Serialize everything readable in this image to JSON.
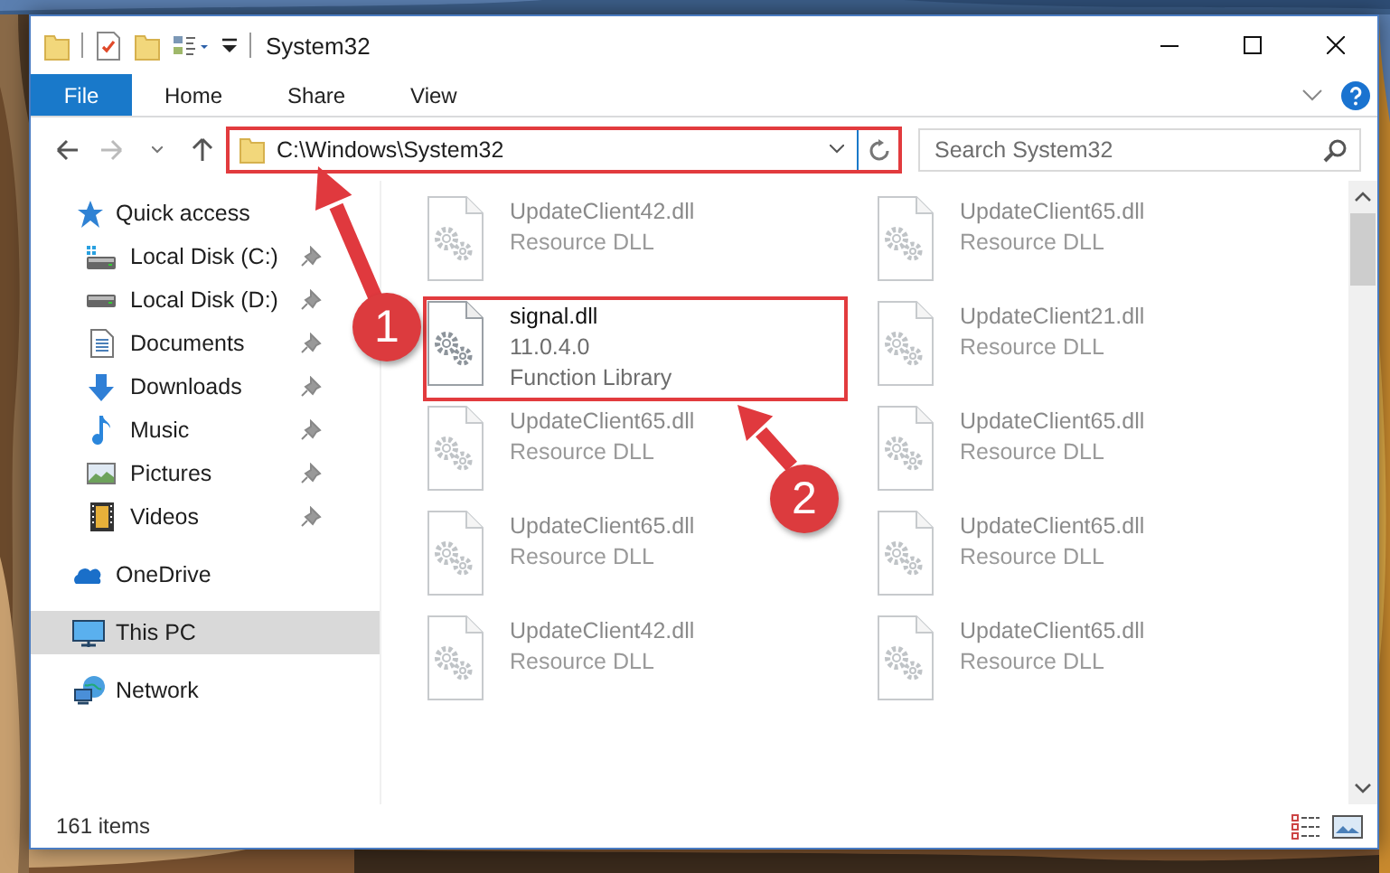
{
  "window": {
    "title": "System32"
  },
  "ribbon": {
    "tabs": [
      {
        "label": "File",
        "kind": "file"
      },
      {
        "label": "Home",
        "kind": "tab"
      },
      {
        "label": "Share",
        "kind": "tab"
      },
      {
        "label": "View",
        "kind": "tab"
      }
    ]
  },
  "address_bar": {
    "path": "C:\\Windows\\System32",
    "highlighted": true
  },
  "search": {
    "placeholder": "Search System32"
  },
  "navigation": [
    {
      "label": "Quick access",
      "selected": false,
      "children": [
        {
          "label": "Local Disk (C:)",
          "pinned": true,
          "selected": false
        },
        {
          "label": "Local Disk (D:)",
          "pinned": true,
          "selected": false
        },
        {
          "label": "Documents",
          "pinned": true,
          "selected": false
        },
        {
          "label": "Downloads",
          "pinned": true,
          "selected": false
        },
        {
          "label": "Music",
          "pinned": true,
          "selected": false
        },
        {
          "label": "Pictures",
          "pinned": true,
          "selected": false
        },
        {
          "label": "Videos",
          "pinned": true,
          "selected": false
        }
      ]
    },
    {
      "label": "OneDrive",
      "selected": false
    },
    {
      "label": "This PC",
      "selected": true
    },
    {
      "label": "Network",
      "selected": false
    }
  ],
  "files": [
    {
      "name": "UpdateClient42.dll",
      "type": "Resource DLL",
      "blurred": true,
      "highlighted": false
    },
    {
      "name": "UpdateClient65.dll",
      "type": "Resource DLL",
      "blurred": true,
      "highlighted": false
    },
    {
      "name": "signal.dll",
      "version": "11.0.4.0",
      "type": "Function Library",
      "blurred": false,
      "highlighted": true
    },
    {
      "name": "UpdateClient21.dll",
      "type": "Resource DLL",
      "blurred": true,
      "highlighted": false
    },
    {
      "name": "UpdateClient65.dll",
      "type": "Resource DLL",
      "blurred": true,
      "highlighted": false
    },
    {
      "name": "UpdateClient65.dll",
      "type": "Resource DLL",
      "blurred": true,
      "highlighted": false
    },
    {
      "name": "UpdateClient65.dll",
      "type": "Resource DLL",
      "blurred": true,
      "highlighted": false
    },
    {
      "name": "UpdateClient65.dll",
      "type": "Resource DLL",
      "blurred": true,
      "highlighted": false
    },
    {
      "name": "UpdateClient42.dll",
      "type": "Resource DLL",
      "blurred": true,
      "highlighted": false
    },
    {
      "name": "UpdateClient65.dll",
      "type": "Resource DLL",
      "blurred": true,
      "highlighted": false
    }
  ],
  "status_bar": {
    "item_count": "161 items"
  },
  "callouts": [
    {
      "number": "1"
    },
    {
      "number": "2"
    }
  ]
}
